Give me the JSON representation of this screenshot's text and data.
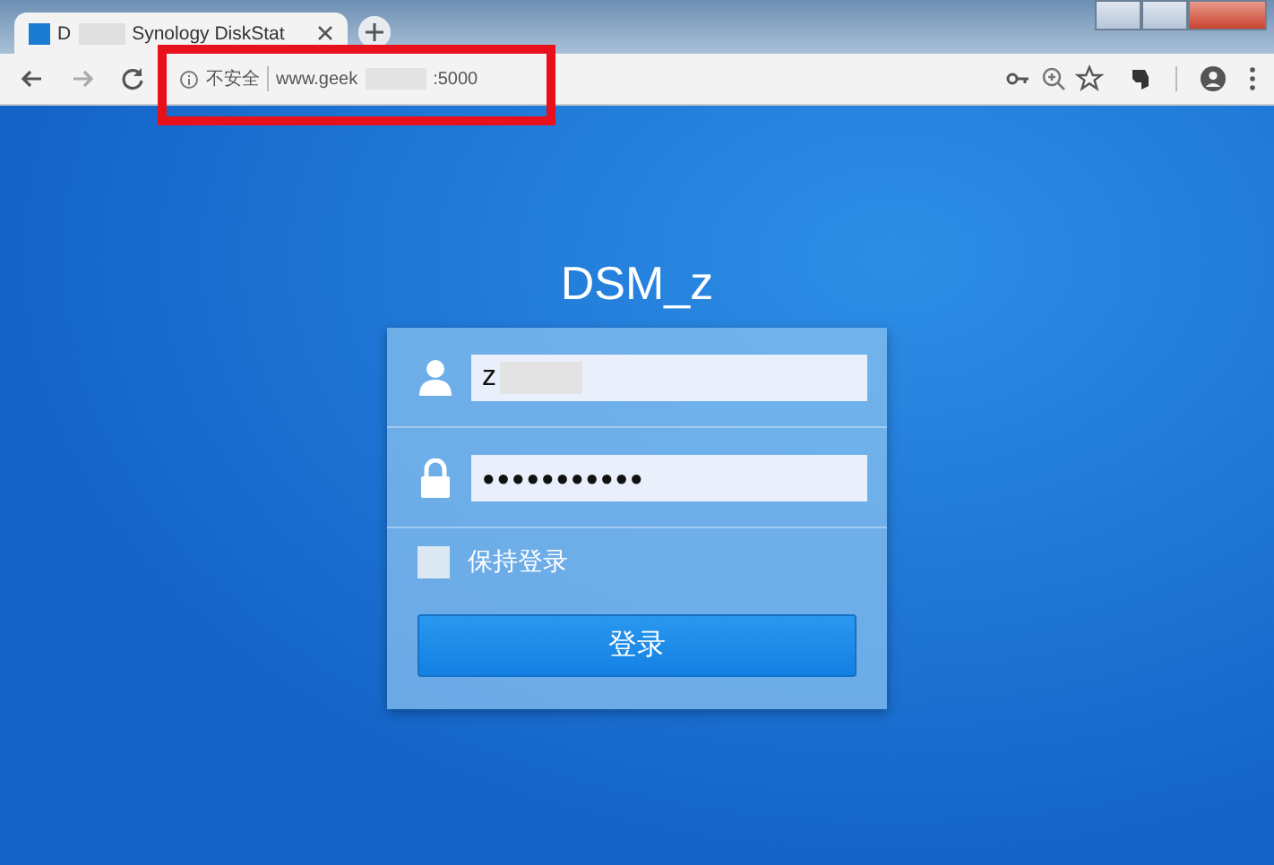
{
  "browser": {
    "tab": {
      "title_start": "D",
      "title_end": "Synology DiskStat",
      "selected": true
    },
    "address": {
      "security": "不安全",
      "url_start": "www.geek",
      "url_end": ":5000"
    },
    "annotation": {
      "kind": "highlight-box",
      "color": "#e8101a"
    }
  },
  "login": {
    "title": "DSM_z",
    "username": {
      "value": "z"
    },
    "password": {
      "value": "●●●●●●●●●●●"
    },
    "remember": {
      "label": "保持登录",
      "checked": false
    },
    "submit": "登录"
  }
}
